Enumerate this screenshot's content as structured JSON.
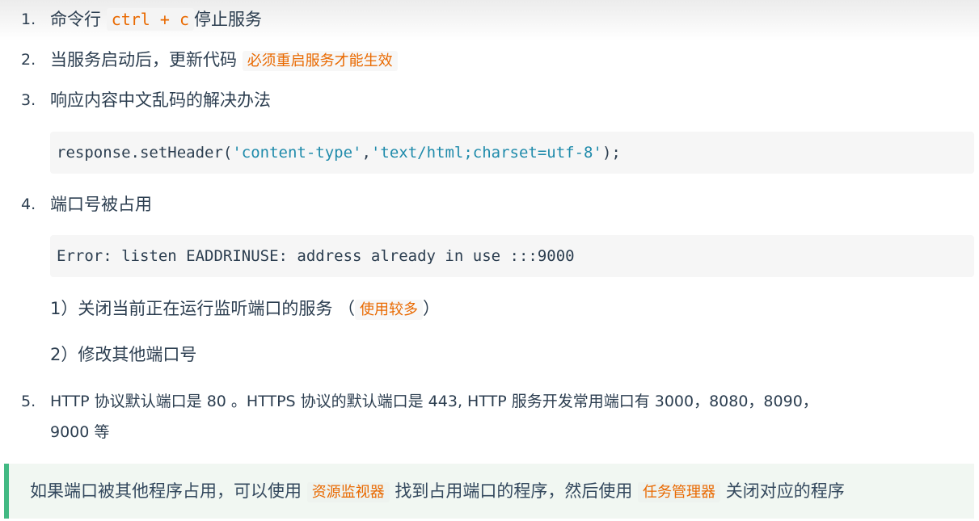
{
  "items": [
    {
      "num": "1.",
      "pre": "命令行 ",
      "code": "ctrl + c",
      "post": "停止服务"
    },
    {
      "num": "2.",
      "pre": "当服务启动后，更新代码 ",
      "hl": "必须重启服务才能生效"
    },
    {
      "num": "3.",
      "text": "响应内容中文乱码的解决办法"
    },
    {
      "num": "4.",
      "text": "端口号被占用"
    },
    {
      "num": "5.",
      "line1": "HTTP 协议默认端口是 80 。HTTPS 协议的默认端口是 443, HTTP 服务开发常用端口有 3000，8080，8090，",
      "line2": "9000 等"
    }
  ],
  "code1": {
    "prefix": "response.setHeader(",
    "arg1": "'content-type'",
    "comma": ",",
    "arg2": "'text/html;charset=utf-8'",
    "suffix": ");"
  },
  "code2": "Error: listen EADDRINUSE: address already in use :::9000",
  "sub": [
    {
      "pre": "1）关闭当前正在运行监听端口的服务 （",
      "hl": "使用较多",
      "post": "）"
    },
    {
      "text": "2）修改其他端口号"
    }
  ],
  "tip": {
    "pre": "如果端口被其他程序占用，可以使用 ",
    "hl1": "资源监视器",
    "mid": " 找到占用端口的程序，然后使用 ",
    "hl2": "任务管理器",
    "post": " 关闭对应的程序"
  },
  "colors": {
    "accent": "#42b983",
    "highlight": "#e96900",
    "string": "#1f8bab"
  }
}
